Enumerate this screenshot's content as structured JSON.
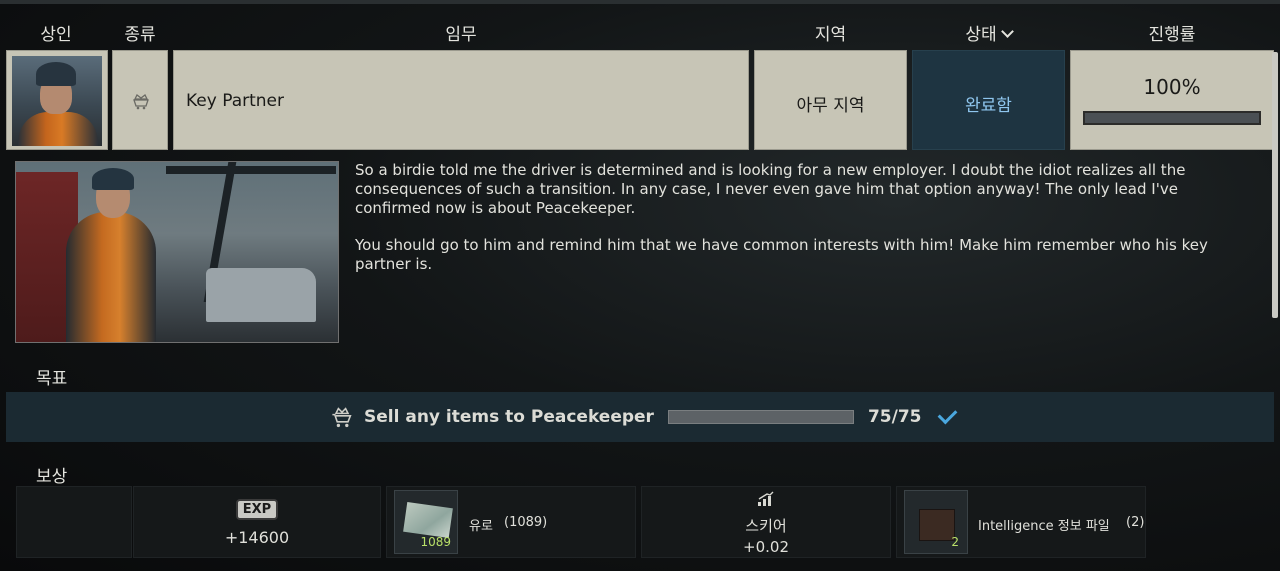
{
  "headers": {
    "trader": "상인",
    "type": "종류",
    "task": "임무",
    "location": "지역",
    "status": "상태",
    "progress": "진행률"
  },
  "quest": {
    "name": "Key Partner",
    "location": "아무 지역",
    "status": "완료함",
    "progress_text": "100%",
    "progress_value": 1.0
  },
  "story": {
    "paragraph1": "So a birdie told me the driver is determined and is looking for a new employer. I doubt the idiot realizes all the consequences of such a transition. In any case, I never even gave him that option anyway! The only lead I've confirmed now is about Peacekeeper.",
    "paragraph2": "You should go to him and remind him that we have common interests with him! Make him remember who his key partner is."
  },
  "objectives": {
    "title": "목표",
    "items": [
      {
        "text": "Sell any items to Peacekeeper",
        "count": "75/75",
        "progress_value": 1.0,
        "icon": "cart-crown-icon"
      }
    ]
  },
  "rewards": {
    "title": "보상",
    "exp_badge": "EXP",
    "exp_value": "+14600",
    "euro_label": "유로",
    "euro_count": "(1089)",
    "euro_qty": "1089",
    "skill_name": "스키어",
    "skill_value": "+0.02",
    "intel_label": "Intelligence 정보 파일",
    "intel_count": "(2)",
    "intel_qty": "2"
  },
  "colors": {
    "status_bg": "#1e3441",
    "status_text": "#8fc6ee",
    "check": "#4aa7de",
    "qty_green": "#b9e069"
  }
}
